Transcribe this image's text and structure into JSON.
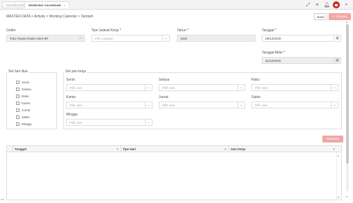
{
  "tabs": [
    {
      "label": "DASHBOARD"
    },
    {
      "label": "WORKING CALENDAR",
      "close": "×"
    }
  ],
  "top_icons": [
    "expand-icon",
    "list-icon",
    "bell-icon"
  ],
  "breadcrumb": "MASTER DATA > Activity > Working Calendar > Tambah",
  "buttons": {
    "batal": "Batal",
    "simpan": "Simpan",
    "simpan_icon": "✔",
    "generate": "Generate"
  },
  "form": {
    "outlet": {
      "label": "Outlet",
      "value": "Toko Toyota Radin Inten BP"
    },
    "tipe_jadwal": {
      "label": "Tipe Jadwal Kerja *",
      "placeholder": "Pilih Kategori"
    },
    "tahun": {
      "label": "Tahun *",
      "value": "2020"
    },
    "tanggal": {
      "label": "Tanggal *",
      "value": "08/12/2020"
    },
    "tanggal_akhir": {
      "label": "Tanggal Akhir *",
      "value": "31/12/2020"
    }
  },
  "libur": {
    "title": "Set hari libur",
    "days": [
      "Senin",
      "Selasa",
      "Rabu",
      "Kamis",
      "Jumat",
      "Sabtu",
      "Minggu"
    ]
  },
  "jam": {
    "title": "Set jam kerja",
    "placeholder": "Pilih Jam",
    "days": [
      "Senin",
      "Selasa",
      "Rabu",
      "Kamis",
      "Jumat",
      "Sabtu",
      "Minggu"
    ]
  },
  "grid": {
    "columns": [
      "Tanggal",
      "Tipe Hari",
      "Jam Kerja"
    ],
    "sort_glyph": "▾"
  },
  "accent": "#e53935",
  "disabled_accent": "#f2a7a7"
}
